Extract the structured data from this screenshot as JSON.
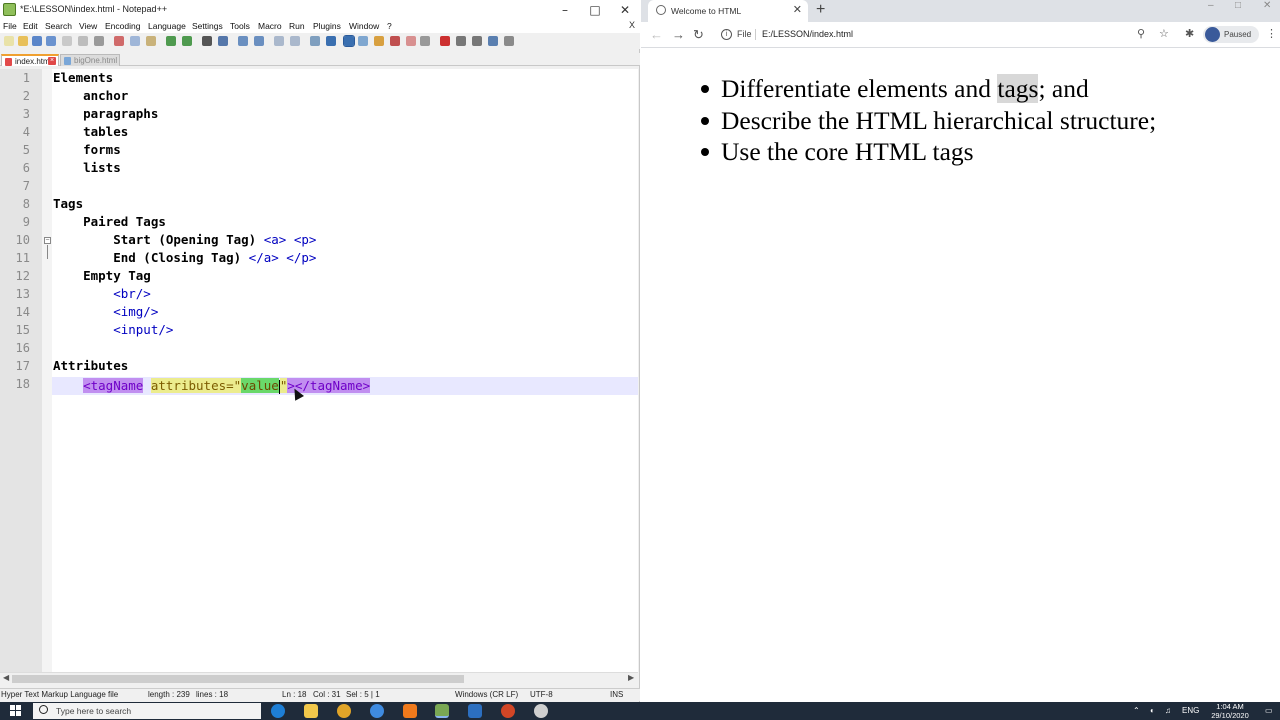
{
  "notepadpp": {
    "title": "*E:\\LESSON\\index.html - Notepad++",
    "menu": [
      "File",
      "Edit",
      "Search",
      "View",
      "Encoding",
      "Language",
      "Settings",
      "Tools",
      "Macro",
      "Run",
      "Plugins",
      "Window",
      "?"
    ],
    "menu_close": "X",
    "tabs": [
      {
        "label": "index.html",
        "active": true
      },
      {
        "label": "bigOne.html",
        "active": false
      }
    ],
    "lines": [
      {
        "n": "1",
        "text": "Elements"
      },
      {
        "n": "2",
        "text": "    anchor"
      },
      {
        "n": "3",
        "text": "    paragraphs"
      },
      {
        "n": "4",
        "text": "    tables"
      },
      {
        "n": "5",
        "text": "    forms"
      },
      {
        "n": "6",
        "text": "    lists"
      },
      {
        "n": "7",
        "text": ""
      },
      {
        "n": "8",
        "text": "Tags"
      },
      {
        "n": "9",
        "text": "    Paired Tags"
      },
      {
        "n": "10",
        "text": "        Start (Opening Tag) ",
        "tags": "<a> <p>"
      },
      {
        "n": "11",
        "text": "        End (Closing Tag) ",
        "tags": "</a> </p>"
      },
      {
        "n": "12",
        "text": "    Empty Tag"
      },
      {
        "n": "13",
        "text": "",
        "tags": "        <br/>"
      },
      {
        "n": "14",
        "text": "",
        "tags": "        <img/>"
      },
      {
        "n": "15",
        "text": "",
        "tags": "        <input/>"
      },
      {
        "n": "16",
        "text": ""
      },
      {
        "n": "17",
        "text": "Attributes"
      },
      {
        "n": "18",
        "text": ""
      }
    ],
    "line18": {
      "indent": "    ",
      "open": "<tagName",
      "space": " ",
      "attr": "attributes=\"",
      "value": "value",
      "quote": "\"",
      "close": "></tagName>"
    },
    "status": {
      "filetype": "Hyper Text Markup Language file",
      "length": "length : 239",
      "lines": "lines : 18",
      "ln": "Ln : 18",
      "col": "Col : 31",
      "sel": "Sel : 5 | 1",
      "eol": "Windows (CR LF)",
      "encoding": "UTF-8",
      "mode": "INS"
    }
  },
  "chrome": {
    "tab_title": "Welcome to HTML",
    "file_label": "File",
    "url": "E:/LESSON/index.html",
    "profile_status": "Paused",
    "bullets": [
      {
        "before": "Differentiate elements and ",
        "selected": "tags",
        "after": "; and"
      },
      {
        "before": "Describe the HTML hierarchical structure;",
        "selected": "",
        "after": ""
      },
      {
        "before": "Use the core HTML tags",
        "selected": "",
        "after": ""
      }
    ]
  },
  "taskbar": {
    "search_placeholder": "Type here to search",
    "language": "ENG",
    "time": "1:04 AM",
    "date": "29/10/2020"
  },
  "colors": {
    "npp_tag_blue": "#0000c0",
    "npp_highlight_purple": "#c18ff0",
    "npp_highlight_yellow": "#ecec8e",
    "npp_highlight_green": "#6ad86a",
    "taskbar_bg": "#1f2b3a"
  }
}
